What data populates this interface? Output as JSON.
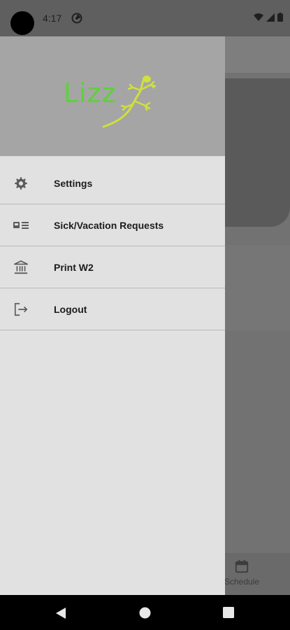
{
  "status_bar": {
    "time": "4:17",
    "icons": [
      "camera-cutout",
      "app-notification-icon",
      "wifi-icon",
      "signal-icon",
      "battery-icon"
    ]
  },
  "drawer": {
    "logo_text": "Lizz",
    "logo_color": "#5ed13a",
    "items": [
      {
        "label": "Settings",
        "icon": "gear-icon"
      },
      {
        "label": "Sick/Vacation Requests",
        "icon": "id-card-icon"
      },
      {
        "label": "Print W2",
        "icon": "bank-icon"
      },
      {
        "label": "Logout",
        "icon": "logout-icon"
      }
    ]
  },
  "background_app": {
    "bottom_nav": {
      "schedule_label": "Schedule",
      "icon": "calendar-icon"
    }
  },
  "navigation_bar": {
    "buttons": [
      "back",
      "home",
      "recents"
    ]
  }
}
